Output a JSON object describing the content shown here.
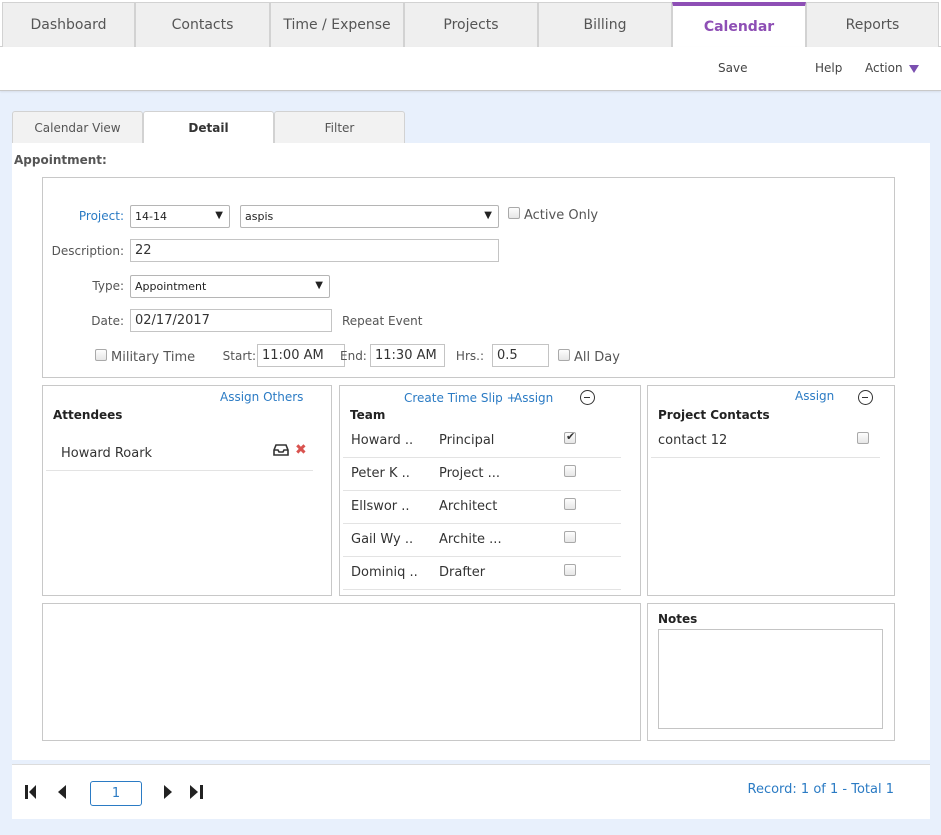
{
  "nav": {
    "tabs": [
      "Dashboard",
      "Contacts",
      "Time / Expense",
      "Projects",
      "Billing",
      "Calendar",
      "Reports"
    ],
    "active": "Calendar"
  },
  "toolbar": {
    "save": "Save",
    "help": "Help",
    "action": "Action"
  },
  "subtabs": [
    "Calendar View",
    "Detail",
    "Filter"
  ],
  "form": {
    "section_title": "Appointment:",
    "project_label": "Project:",
    "project_value": "14-14",
    "project_name": "aspis",
    "active_only": "Active Only",
    "description_label": "Description:",
    "description_value": "22",
    "type_label": "Type:",
    "type_value": "Appointment",
    "date_label": "Date:",
    "date_value": "02/17/2017",
    "repeat_event": "Repeat Event",
    "military_time": "Military Time",
    "start_label": "Start:",
    "start_value": "11:00 AM",
    "end_label": "End:",
    "end_value": "11:30 AM",
    "hrs_label": "Hrs.:",
    "hrs_value": "0.5",
    "all_day": "All Day"
  },
  "attendees": {
    "link": "Assign Others",
    "header": "Attendees",
    "items": [
      {
        "name": "Howard Roark"
      }
    ]
  },
  "team": {
    "create_link": "Create Time Slip +",
    "assign_link": "Assign",
    "header": "Team",
    "rows": [
      {
        "name": "Howard  ..",
        "role": "Principal",
        "checked": true
      },
      {
        "name": "Peter K ..",
        "role": "Project ...",
        "checked": false
      },
      {
        "name": "Ellswor ..",
        "role": "Architect",
        "checked": false
      },
      {
        "name": "Gail Wy ..",
        "role": "Archite ...",
        "checked": false
      },
      {
        "name": "Dominiq ..",
        "role": "Drafter",
        "checked": false
      }
    ]
  },
  "contacts": {
    "assign_link": "Assign",
    "header": "Project Contacts",
    "rows": [
      {
        "name": "contact 12",
        "checked": false
      }
    ]
  },
  "notes": {
    "header": "Notes",
    "value": ""
  },
  "pager": {
    "page": "1",
    "record_text": "Record: 1 of 1 - Total 1"
  },
  "colors": {
    "accent": "#8e4fb5",
    "link": "#2b7bc4",
    "delete": "#d9534f"
  }
}
